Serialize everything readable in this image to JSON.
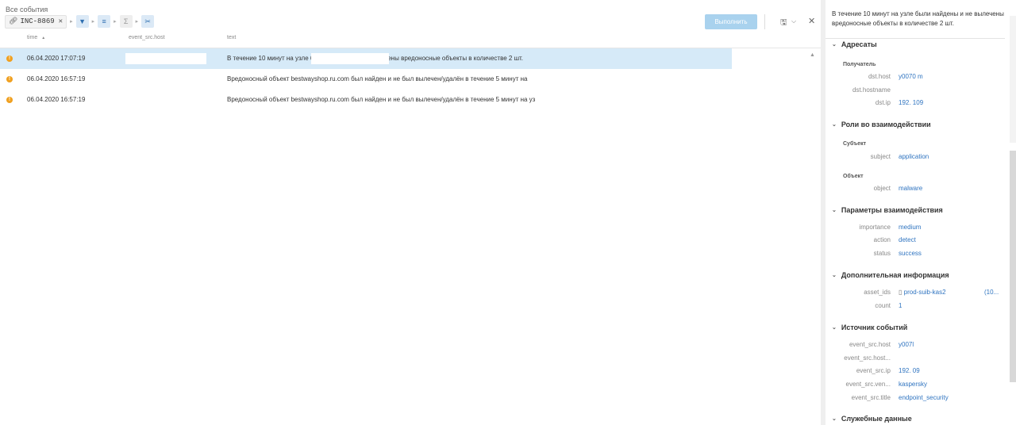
{
  "events_panel": {
    "title": "Все события",
    "filter_chip": {
      "icon": "link-icon",
      "value": "INC-8869"
    },
    "run_label": "Выполнить",
    "columns": {
      "time": "time",
      "sort_indicator": "▲",
      "host": "event_src.host",
      "text": "text"
    },
    "rows": [
      {
        "time": "06.04.2020 17:07:19",
        "host": "",
        "text": "В течение 10 минут на узле                                                были найдены и не вылечены вредоносные объекты в количестве 2 шт.",
        "selected": true
      },
      {
        "time": "06.04.2020 16:57:19",
        "host": "",
        "text": "Вредоносный объект bestwayshop.ru.com был найден и не был вылечен/удалён в течение 5 минут на",
        "selected": false
      },
      {
        "time": "06.04.2020 16:57:19",
        "host": "",
        "text": "Вредоносный объект bestwayshop.ru.com был найден и не был вылечен/удалён в течение 5 минут на уз",
        "selected": false
      }
    ]
  },
  "details_panel": {
    "header": "В течение 10 минут на узле                                  были найдены и не вылечены вредоносные объекты в количестве 2 шт.",
    "sections": {
      "addresses": "Адресаты",
      "roles": "Роли во взаимодействии",
      "params": "Параметры взаимодействия",
      "extra": "Дополнительная информация",
      "source": "Источник событий",
      "service": "Служебные данные"
    },
    "subsections": {
      "recipient": "Получатель",
      "subject": "Субъект",
      "object": "Объект"
    },
    "fields": {
      "dst_host_key": "dst.host",
      "dst_host_val": "y0070                    m",
      "dst_hostname_key": "dst.hostname",
      "dst_hostname_val": "",
      "dst_ip_key": "dst.ip",
      "dst_ip_val": "192.        109",
      "subject_key": "subject",
      "subject_val": "application",
      "object_key": "object",
      "object_val": "malware",
      "importance_key": "importance",
      "importance_val": "medium",
      "action_key": "action",
      "action_val": "detect",
      "status_key": "status",
      "status_val": "success",
      "asset_ids_key": "asset_ids",
      "asset_ids_val": "prod-suib-kas2",
      "asset_ids_extra": "(10...",
      "count_key": "count",
      "count_val": "1",
      "src_host_key": "event_src.host",
      "src_host_val": "y007l",
      "src_hostname_key": "event_src.host...",
      "src_hostname_val": "",
      "src_ip_key": "event_src.ip",
      "src_ip_val": "192.      09",
      "src_vendor_key": "event_src.ven...",
      "src_vendor_val": "kaspersky",
      "src_title_key": "event_src.title",
      "src_title_val": "endpoint_security"
    }
  },
  "colors": {
    "accent": "#2f74c0",
    "selected_row": "#d6eaf8",
    "warning": "#f0a020",
    "run_button": "#a9d2ee"
  }
}
